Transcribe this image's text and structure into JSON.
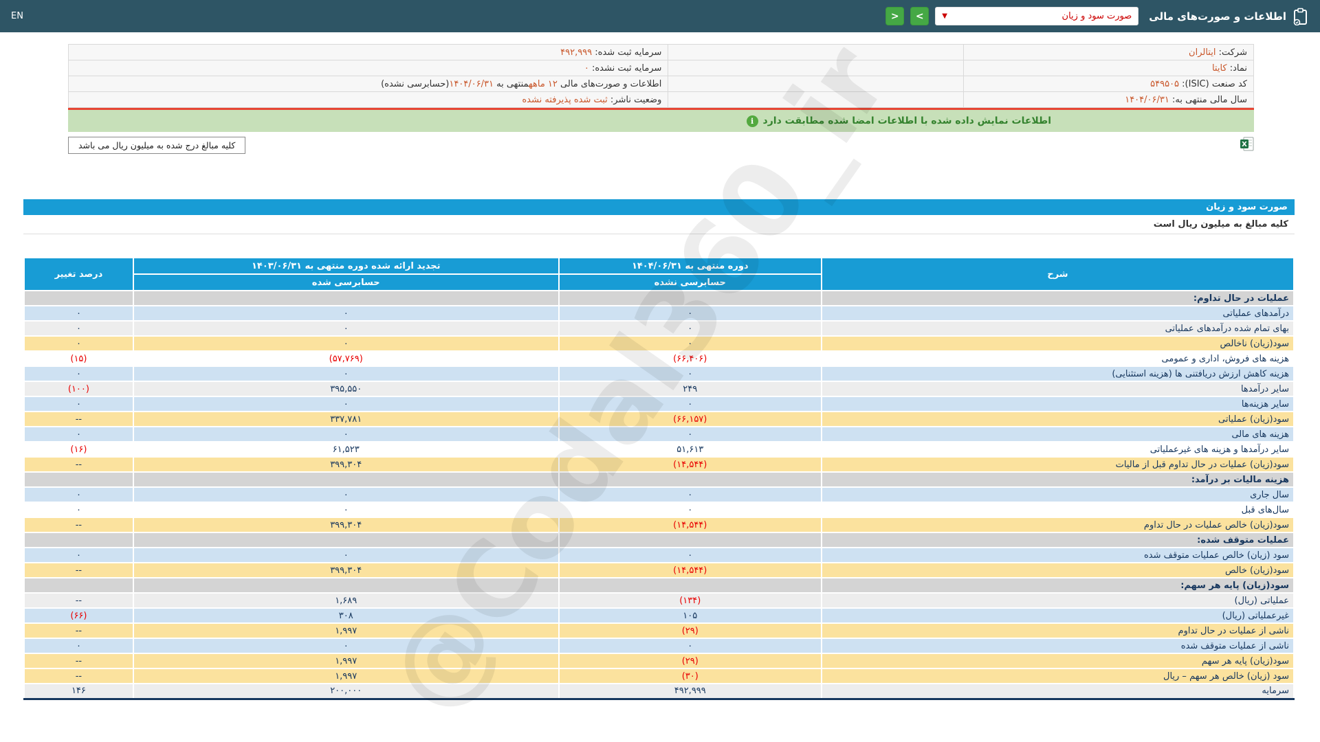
{
  "navbar": {
    "en_label": "EN",
    "title": "اطلاعات و صورت‌های مالی",
    "dropdown_value": "صورت سود و زیان",
    "next_button": ">",
    "prev_button": "<"
  },
  "company_info": {
    "rows": [
      {
        "right": [
          [
            "شرکت: ",
            false
          ],
          [
            "ایتالران",
            true
          ]
        ],
        "left": [
          [
            "سرمایه ثبت شده: ",
            false
          ],
          [
            "۴۹۲,۹۹۹",
            true
          ]
        ]
      },
      {
        "right": [
          [
            "نماد: ",
            false
          ],
          [
            "کایتا",
            true
          ]
        ],
        "left": [
          [
            "سرمایه ثبت نشده: ",
            false
          ],
          [
            "۰",
            true
          ]
        ]
      },
      {
        "right": [
          [
            "کد صنعت (ISIC): ",
            false
          ],
          [
            "۵۴۹۵۰۵",
            true
          ]
        ],
        "left": [
          [
            "اطلاعات و صورت‌های مالی ",
            false
          ],
          [
            "۱۲ ماهه",
            true
          ],
          [
            "منتهی به ",
            false
          ],
          [
            "۱۴۰۴/۰۶/۳۱",
            true
          ],
          [
            "(حسابرسی نشده)",
            false
          ]
        ]
      },
      {
        "right": [
          [
            "سال مالی منتهی به: ",
            false
          ],
          [
            "۱۴۰۴/۰۶/۳۱",
            true
          ]
        ],
        "left": [
          [
            "وضعیت ناشر: ",
            false
          ],
          [
            "ثبت شده پذیرفته نشده",
            true
          ]
        ]
      }
    ]
  },
  "banner": {
    "text": "اطلاعات نمایش داده شده با اطلاعات امضا شده مطابقت دارد",
    "icon": "i"
  },
  "note_box": "کلیه مبالغ درج شده به میلیون ریال می باشد",
  "excel_icon": "excel-export",
  "statement": {
    "title": "صورت سود و زیان",
    "amounts_note": "کلیه مبالغ به میلیون ریال است",
    "columns": {
      "desc": "شرح",
      "current_period": "دوره منتهی به ۱۴۰۴/۰۶/۳۱",
      "current_sub": "حسابرسی نشده",
      "restated_period": "تجدید ارائه شده دوره منتهی به ۱۴۰۳/۰۶/۳۱",
      "restated_sub": "حسابرسی شده",
      "change": "درصد تغییر"
    },
    "rows": [
      {
        "label": "عملیات در حال تداوم:",
        "type": "section",
        "v": [
          "",
          "",
          ""
        ]
      },
      {
        "label": "درآمدهای عملیاتی",
        "bg": "blue",
        "v": [
          "۰",
          "۰",
          "۰"
        ]
      },
      {
        "label": "بهای تمام شده درآمدهای عملیاتی",
        "bg": "gray",
        "v": [
          "۰",
          "۰",
          "۰"
        ]
      },
      {
        "label": "سود(زیان) ناخالص",
        "bg": "yellow",
        "v": [
          "۰",
          "۰",
          "۰"
        ]
      },
      {
        "label": "هزینه های فروش، اداری و عمومی",
        "bg": "white",
        "v": [
          "(۶۶,۴۰۶)",
          "(۵۷,۷۶۹)",
          "(۱۵)"
        ]
      },
      {
        "label": "هزینه کاهش ارزش دریافتنی ها (هزینه استثنایی)",
        "bg": "blue",
        "v": [
          "۰",
          "۰",
          "۰"
        ]
      },
      {
        "label": "سایر درآمدها",
        "bg": "gray",
        "v": [
          "۲۴۹",
          "۳۹۵,۵۵۰",
          "(۱۰۰)"
        ]
      },
      {
        "label": "سایر هزینه‌ها",
        "bg": "blue",
        "v": [
          "۰",
          "۰",
          "۰"
        ]
      },
      {
        "label": "سود(زیان) عملیاتی",
        "bg": "yellow",
        "v": [
          "(۶۶,۱۵۷)",
          "۳۳۷,۷۸۱",
          "--"
        ]
      },
      {
        "label": "هزینه های مالی",
        "bg": "blue",
        "v": [
          "۰",
          "۰",
          "۰"
        ]
      },
      {
        "label": "سایر درآمدها و هزینه های غیرعملیاتی",
        "bg": "white",
        "v": [
          "۵۱,۶۱۳",
          "۶۱,۵۲۳",
          "(۱۶)"
        ]
      },
      {
        "label": "سود(زیان) عملیات در حال تداوم قبل از مالیات",
        "bg": "yellow",
        "v": [
          "(۱۴,۵۴۴)",
          "۳۹۹,۳۰۴",
          "--"
        ]
      },
      {
        "label": "هزینه مالیات بر درآمد:",
        "type": "section",
        "v": [
          "",
          "",
          ""
        ]
      },
      {
        "label": "سال جاری",
        "bg": "blue",
        "v": [
          "۰",
          "۰",
          "۰"
        ]
      },
      {
        "label": "سال‌های قبل",
        "bg": "white",
        "v": [
          "۰",
          "۰",
          "۰"
        ]
      },
      {
        "label": "سود(زیان) خالص عملیات در حال تداوم",
        "bg": "yellow",
        "v": [
          "(۱۴,۵۴۴)",
          "۳۹۹,۳۰۴",
          "--"
        ]
      },
      {
        "label": "عملیات متوقف شده:",
        "type": "section",
        "v": [
          "",
          "",
          ""
        ]
      },
      {
        "label": "سود (زیان) خالص عملیات متوقف شده",
        "bg": "blue",
        "v": [
          "۰",
          "۰",
          "۰"
        ]
      },
      {
        "label": "سود(زیان) خالص",
        "bg": "yellow",
        "v": [
          "(۱۴,۵۴۴)",
          "۳۹۹,۳۰۴",
          "--"
        ]
      },
      {
        "label": "سود(زیان) پایه هر سهم:",
        "type": "section",
        "v": [
          "",
          "",
          ""
        ]
      },
      {
        "label": "عملیاتی (ریال)",
        "bg": "gray",
        "v": [
          "(۱۳۴)",
          "۱,۶۸۹",
          "--"
        ]
      },
      {
        "label": "غیرعملیاتی (ریال)",
        "bg": "blue",
        "v": [
          "۱۰۵",
          "۳۰۸",
          "(۶۶)"
        ]
      },
      {
        "label": "ناشی از عملیات در حال تداوم",
        "bg": "yellow",
        "v": [
          "(۲۹)",
          "۱,۹۹۷",
          "--"
        ]
      },
      {
        "label": "ناشی از عملیات متوقف شده",
        "bg": "blue",
        "v": [
          "۰",
          "۰",
          "۰"
        ]
      },
      {
        "label": "سود(زیان) پایه هر سهم",
        "bg": "yellow",
        "v": [
          "(۲۹)",
          "۱,۹۹۷",
          "--"
        ]
      },
      {
        "label": "سود (زیان) خالص هر سهم – ریال",
        "bg": "yellow",
        "v": [
          "(۳۰)",
          "۱,۹۹۷",
          "--"
        ]
      },
      {
        "label": "سرمایه",
        "bg": "gray",
        "v": [
          "۴۹۲,۹۹۹",
          "۲۰۰,۰۰۰",
          "۱۴۶"
        ]
      }
    ]
  },
  "watermark": "@Codal360_ir",
  "colors": {
    "navbar": "#2e5565",
    "accent_blue": "#189cd5",
    "green_button": "#45a845",
    "banner_green": "#c7e0b9",
    "banner_text": "#35832f",
    "value_orange": "#c9572b",
    "negative_red": "#e80000",
    "value_navy": "#17375e",
    "row_blue": "#cee1f2",
    "row_yellow": "#fbe29e",
    "row_gray": "#ededed",
    "section_gray": "#d4d4d4",
    "red_divider": "#e74634"
  }
}
